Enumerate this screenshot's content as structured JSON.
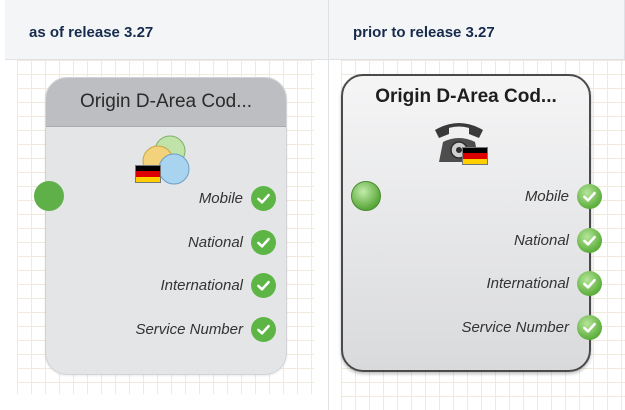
{
  "columns": [
    {
      "header": "as of release 3.27",
      "node": {
        "title": "Origin D-Area Cod...",
        "icon": "colored-circles-with-german-flag-icon",
        "outputs": [
          {
            "label": "Mobile"
          },
          {
            "label": "National"
          },
          {
            "label": "International"
          },
          {
            "label": "Service Number"
          }
        ]
      }
    },
    {
      "header": "prior to release 3.27",
      "node": {
        "title": "Origin D-Area Cod...",
        "icon": "telephone-with-german-flag-icon",
        "outputs": [
          {
            "label": "Mobile"
          },
          {
            "label": "National"
          },
          {
            "label": "International"
          },
          {
            "label": "Service Number"
          }
        ]
      }
    }
  ],
  "colors": {
    "check_green": "#5cb545",
    "flag_black": "#000000",
    "flag_red": "#dd0000",
    "flag_gold": "#ffce00"
  }
}
